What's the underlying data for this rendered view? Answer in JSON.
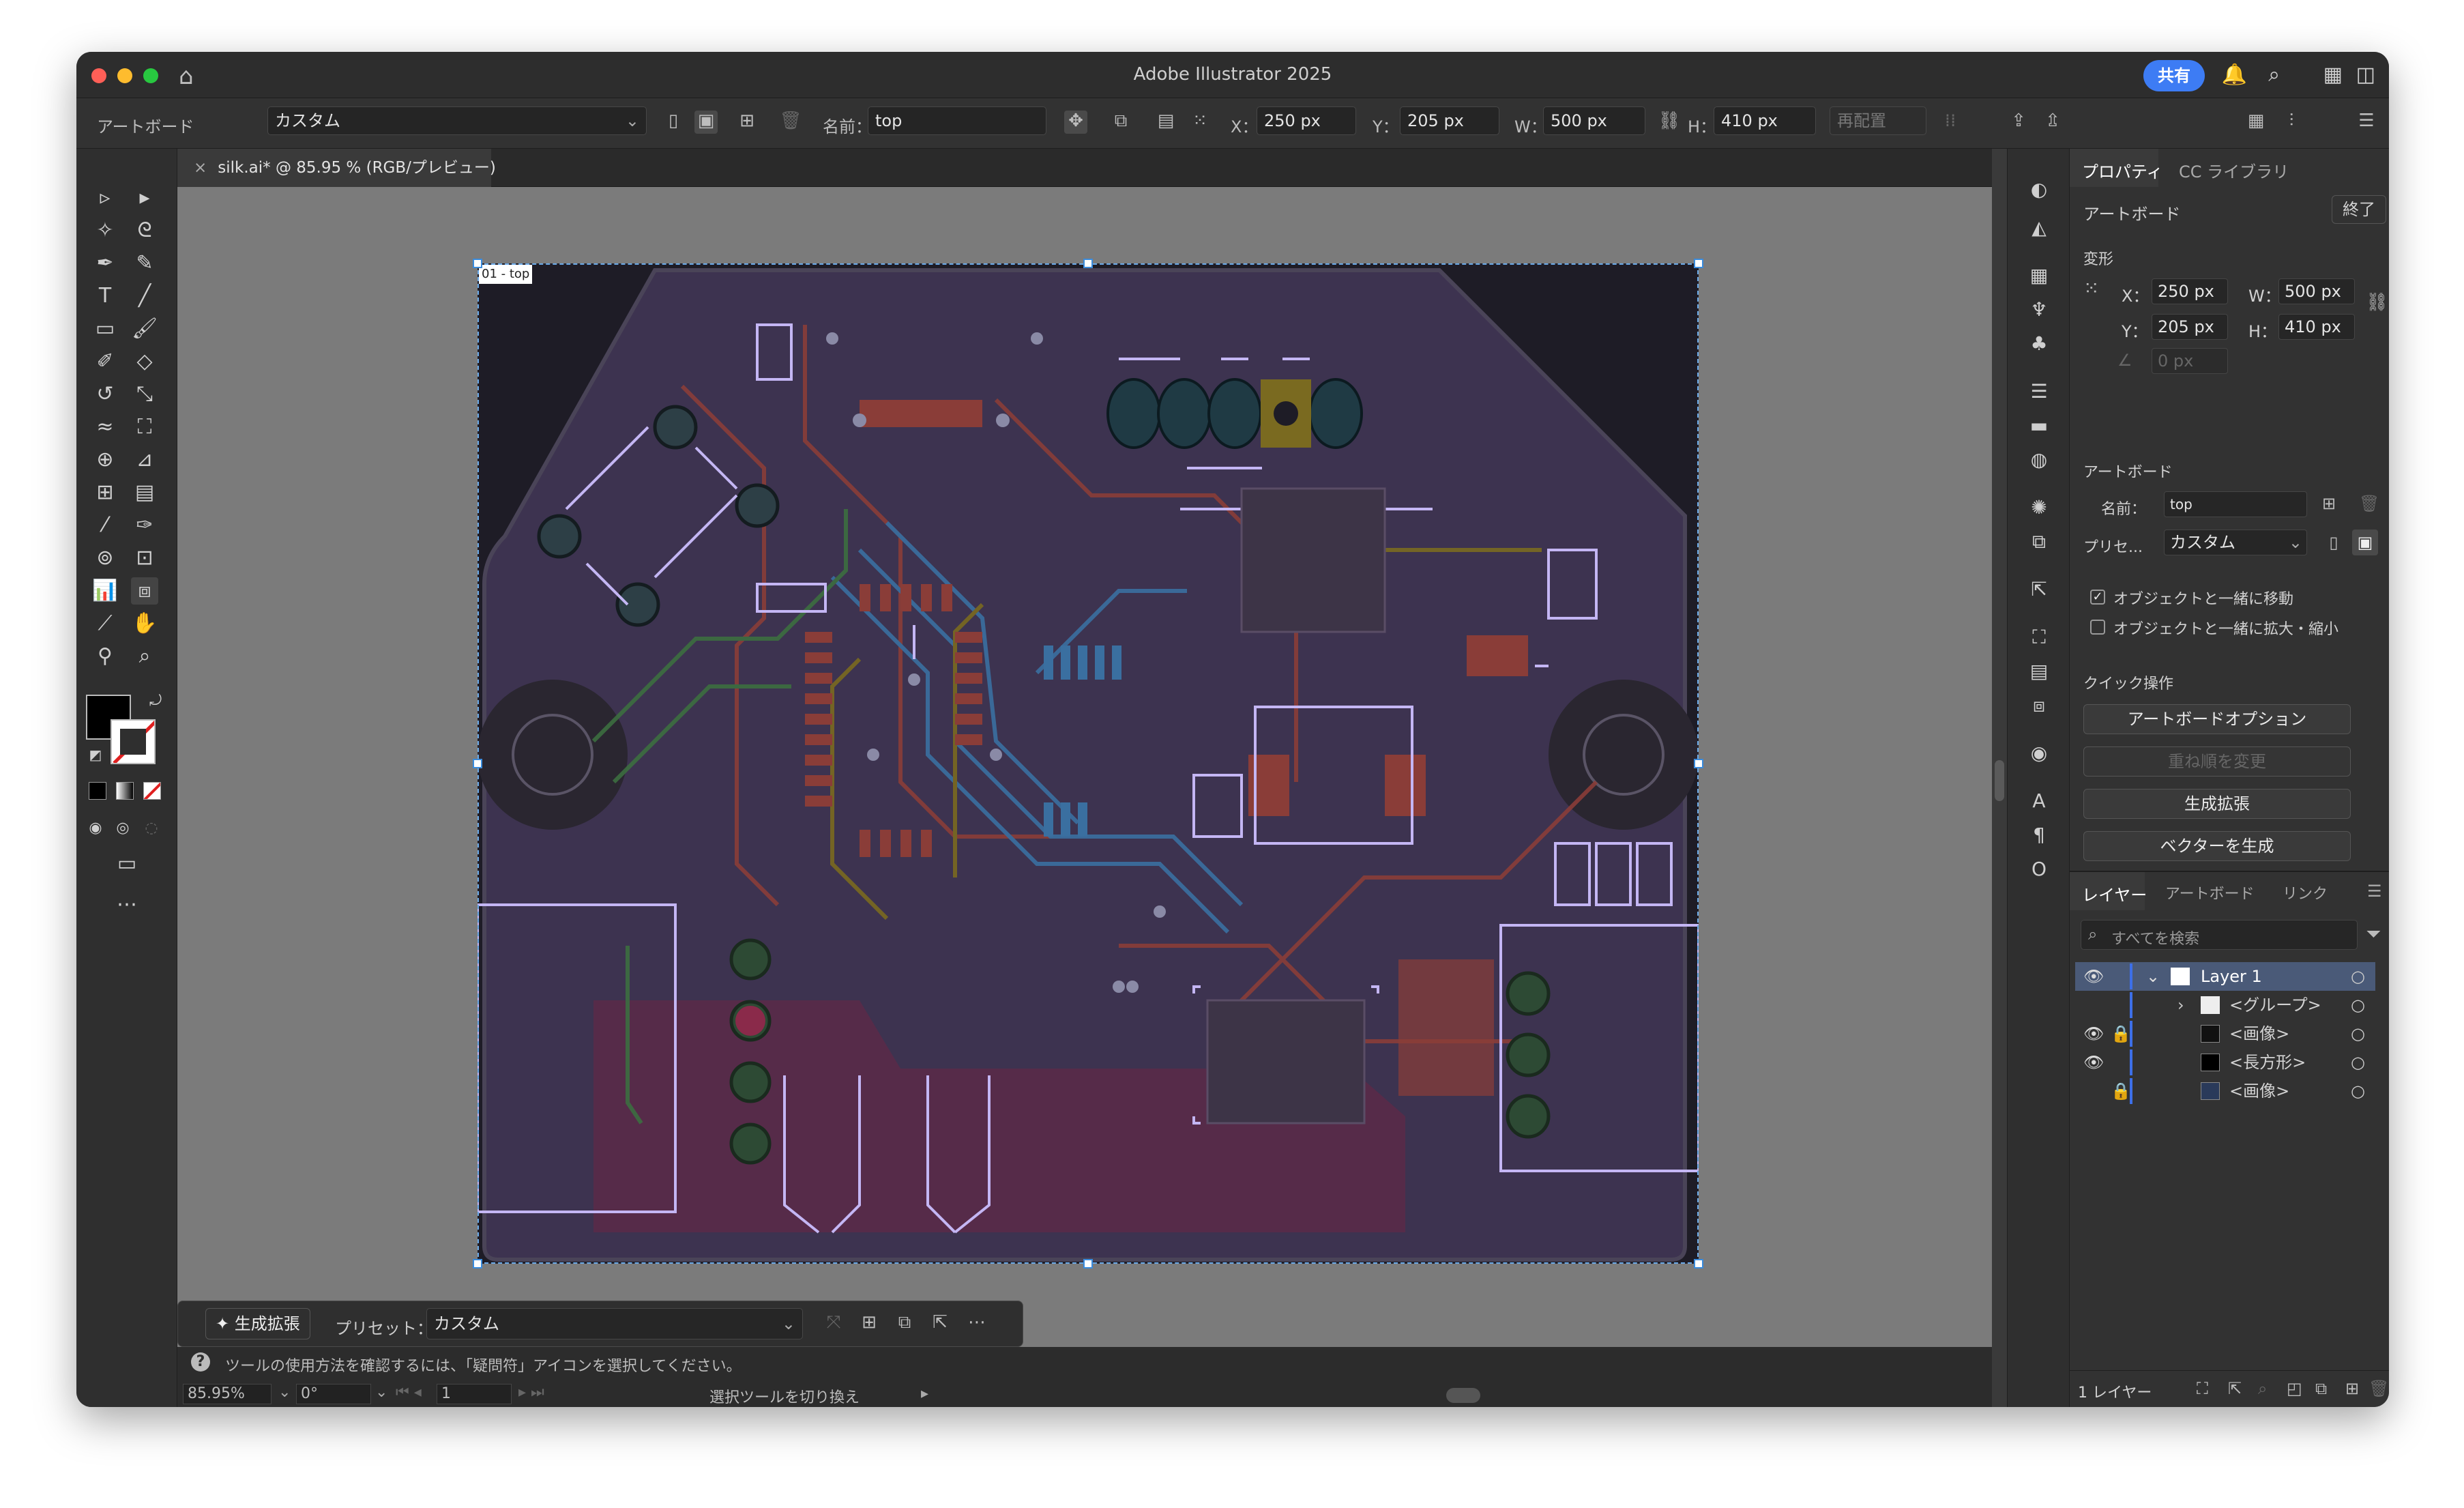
{
  "window": {
    "title": "Adobe Illustrator 2025",
    "share_label": "共有"
  },
  "control_bar": {
    "mode_label": "アートボード",
    "preset_value": "カスタム",
    "name_label": "名前：",
    "name_value": "top",
    "x_label": "X：",
    "x_value": "250 px",
    "y_label": "Y：",
    "y_value": "205 px",
    "w_label": "W：",
    "w_value": "500 px",
    "h_label": "H：",
    "h_value": "410 px",
    "rearrange_label": "再配置"
  },
  "document": {
    "tab_title": "silk.ai* @ 85.95 % (RGB/プレビュー)",
    "artboard_label": "01 - top"
  },
  "properties_panel": {
    "tabs": [
      "プロパティ",
      "CC ライブラリ"
    ],
    "section_title": "アートボード",
    "done_label": "終了",
    "transform": {
      "title": "変形",
      "x_label": "X：",
      "x_value": "250 px",
      "y_label": "Y：",
      "y_value": "205 px",
      "w_label": "W：",
      "w_value": "500 px",
      "h_label": "H：",
      "h_value": "410 px",
      "angle_value": "0 px"
    },
    "artboard": {
      "title": "アートボード",
      "name_label": "名前：",
      "name_value": "top",
      "preset_label": "プリセ...",
      "preset_value": "カスタム"
    },
    "checkboxes": [
      {
        "label": "オブジェクトと一緒に移動",
        "checked": true
      },
      {
        "label": "オブジェクトと一緒に拡大・縮小",
        "checked": false
      }
    ],
    "quick_actions": {
      "title": "クイック操作",
      "buttons": [
        "アートボードオプション",
        "重ね順を変更",
        "生成拡張",
        "ベクターを生成"
      ]
    }
  },
  "layers_panel": {
    "tabs": [
      "レイヤー",
      "アートボード",
      "リンク"
    ],
    "search_placeholder": "すべてを検索",
    "rows": [
      {
        "name": "Layer 1"
      },
      {
        "name": "<グループ>"
      },
      {
        "name": "<画像>"
      },
      {
        "name": "<長方形>"
      },
      {
        "name": "<画像>"
      }
    ],
    "footer_label": "1 レイヤー"
  },
  "gen_bar": {
    "button_label": "生成拡張",
    "preset_label": "プリセット：",
    "preset_value": "カスタム"
  },
  "status": {
    "hint": "ツールの使用方法を確認するには、「疑問符」アイコンを選択してください。",
    "zoom": "85.95%",
    "rotation": "0°",
    "artboard_index": "1",
    "tool_status": "選択ツールを切り換え"
  },
  "colors": {
    "accent": "#3d7cf4",
    "artboard_bg": "#262232",
    "silk_line": "#c4b6f4",
    "trace_red": "#8a3d38",
    "trace_blue": "#3a6fa0",
    "trace_green": "#3c6e40",
    "trace_yellow": "#7a6a20"
  }
}
